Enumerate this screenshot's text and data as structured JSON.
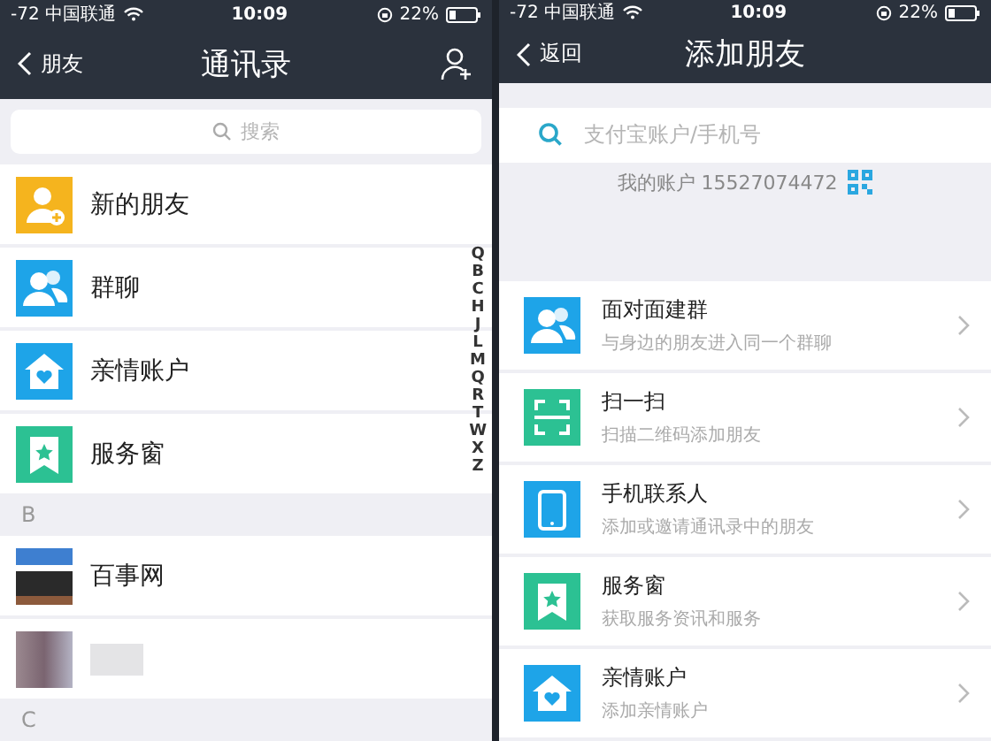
{
  "left_screen": {
    "status_bar": {
      "carrier": "-72 中国联通",
      "time": "10:09",
      "battery": "22%"
    },
    "nav": {
      "back": "朋友",
      "title": "通讯录"
    },
    "search": {
      "placeholder": "搜索"
    },
    "items": [
      {
        "kind": "new_friends",
        "label": "新的朋友",
        "color": "#f5b41e"
      },
      {
        "kind": "group_chat",
        "label": "群聊",
        "color": "#1ea4e8"
      },
      {
        "kind": "family",
        "label": "亲情账户",
        "color": "#1ea4e8"
      },
      {
        "kind": "service",
        "label": "服务窗",
        "color": "#2cc193"
      },
      {
        "kind": "section",
        "label": "B"
      },
      {
        "kind": "photo",
        "label": "百事网"
      },
      {
        "kind": "blurred"
      },
      {
        "kind": "section",
        "label": "C"
      }
    ],
    "index": [
      "Q",
      "B",
      "C",
      "H",
      "J",
      "L",
      "M",
      "Q",
      "R",
      "T",
      "W",
      "X",
      "Z"
    ]
  },
  "right_screen": {
    "status_bar": {
      "carrier": "-72 中国联通",
      "time": "10:09",
      "battery": "22%"
    },
    "nav": {
      "back": "返回",
      "title": "添加朋友"
    },
    "search": {
      "placeholder": "支付宝账户/手机号"
    },
    "account": "我的账户 15527074472",
    "items": [
      {
        "kind": "face_group",
        "title": "面对面建群",
        "subtitle": "与身边的朋友进入同一个群聊",
        "color": "#1ea4e8"
      },
      {
        "kind": "scan",
        "title": "扫一扫",
        "subtitle": "扫描二维码添加朋友",
        "color": "#2cc193"
      },
      {
        "kind": "phone",
        "title": "手机联系人",
        "subtitle": "添加或邀请通讯录中的朋友",
        "color": "#1ea4e8"
      },
      {
        "kind": "service",
        "title": "服务窗",
        "subtitle": "获取服务资讯和服务",
        "color": "#2cc193"
      },
      {
        "kind": "family",
        "title": "亲情账户",
        "subtitle": "添加亲情账户",
        "color": "#1ea4e8"
      }
    ]
  }
}
